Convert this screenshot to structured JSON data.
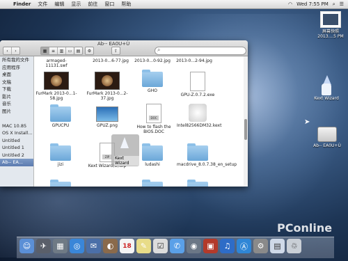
{
  "menubar": {
    "apple": "",
    "app": "Finder",
    "items": [
      "文件",
      "编辑",
      "显示",
      "前往",
      "窗口",
      "帮助"
    ],
    "time": "Wed 7:55 PM"
  },
  "desktop": {
    "screenshot_label": "屏幕快照",
    "screenshot_date": "2013....5 PM",
    "kext_label": "Kext Wizard",
    "drive_label": "Ab-- EA0U+Ù"
  },
  "window": {
    "title": "Ab-- EA0U+Ù",
    "sidebar": [
      "所有我的文件",
      "应用程序",
      "桌面",
      "文稿",
      "下载",
      "影片",
      "音乐",
      "图片",
      "",
      "MAC 10.85",
      "OS X Install...",
      "Untitled",
      "Untitled 1",
      "Untitled 2",
      "Ab-- EA..."
    ],
    "files_row0": [
      "armaged-11131.swf",
      "2013-0...6-77.jpg",
      "2013-0...0-92.jpg",
      "2013-0...2-94.jpg"
    ],
    "files_row1": [
      "FurMark 2013-0...1-58.jpg",
      "FurMark 2013-0...2-37.jpg",
      "GHO",
      "GPU-Z.0.7.2.exe"
    ],
    "files_row2": [
      "GPUCPU",
      "GPUZ.png",
      "How to flash the BIOS.DOC",
      "Intel82566DM32.kext"
    ],
    "files_row3": [
      "jizi",
      "Kext Wizard(1).zip",
      "ludashi",
      "macdrive_8.0.7.38_en_setup"
    ],
    "drag_label": "Kext Wizard",
    "doc_tag": "DOC",
    "zip_tag": "ZIP"
  },
  "dock": {
    "calendar_day": "18"
  },
  "watermark": "PConline"
}
